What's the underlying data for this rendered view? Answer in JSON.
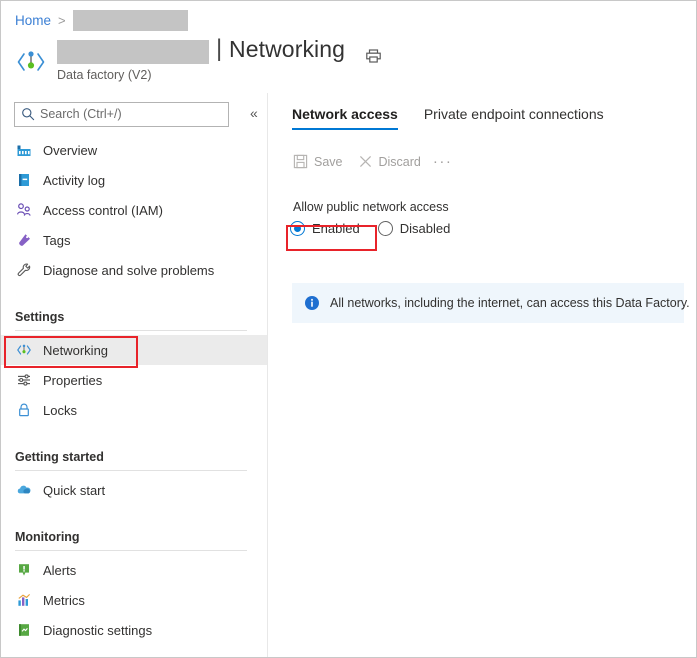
{
  "breadcrumb": {
    "home_label": "Home",
    "separator": ">",
    "redacted_resource": ""
  },
  "header": {
    "resource_name_redacted": "",
    "pipe": "|",
    "page_title": "Networking",
    "subtitle": "Data factory (V2)",
    "print_icon": "printer-icon",
    "resource_icon": "data-factory-icon"
  },
  "sidebar": {
    "search": {
      "placeholder": "Search (Ctrl+/)",
      "value": "",
      "icon": "search-icon"
    },
    "collapse_label": "«",
    "items": [
      {
        "label": "Overview",
        "icon": "factory-icon",
        "selected": false
      },
      {
        "label": "Activity log",
        "icon": "activity-log-icon",
        "selected": false
      },
      {
        "label": "Access control (IAM)",
        "icon": "people-icon",
        "selected": false
      },
      {
        "label": "Tags",
        "icon": "tag-icon",
        "selected": false
      },
      {
        "label": "Diagnose and solve problems",
        "icon": "wrench-icon",
        "selected": false
      }
    ],
    "sections": [
      {
        "header": "Settings",
        "items": [
          {
            "label": "Networking",
            "icon": "networking-icon",
            "selected": true
          },
          {
            "label": "Properties",
            "icon": "properties-sliders-icon",
            "selected": false
          },
          {
            "label": "Locks",
            "icon": "lock-icon",
            "selected": false
          }
        ]
      },
      {
        "header": "Getting started",
        "items": [
          {
            "label": "Quick start",
            "icon": "cloud-icon",
            "selected": false
          }
        ]
      },
      {
        "header": "Monitoring",
        "items": [
          {
            "label": "Alerts",
            "icon": "alert-icon",
            "selected": false
          },
          {
            "label": "Metrics",
            "icon": "metrics-chart-icon",
            "selected": false
          },
          {
            "label": "Diagnostic settings",
            "icon": "diagnostic-settings-icon",
            "selected": false
          }
        ]
      }
    ]
  },
  "main": {
    "tabs": [
      {
        "label": "Network access",
        "active": true
      },
      {
        "label": "Private endpoint connections",
        "active": false
      }
    ],
    "toolbar": {
      "save_label": "Save",
      "save_icon": "save-disk-icon",
      "discard_label": "Discard",
      "discard_icon": "close-x-icon",
      "more_label": "···"
    },
    "setting": {
      "label": "Allow public network access",
      "options": [
        {
          "label": "Enabled",
          "checked": true
        },
        {
          "label": "Disabled",
          "checked": false
        }
      ]
    },
    "info": {
      "icon": "info-circle-icon",
      "text": "All networks, including the internet, can access this Data Factory."
    }
  },
  "highlights": {
    "color": "#e8232a",
    "targets": [
      "sidebar-item-networking",
      "radio-option-enabled"
    ]
  }
}
